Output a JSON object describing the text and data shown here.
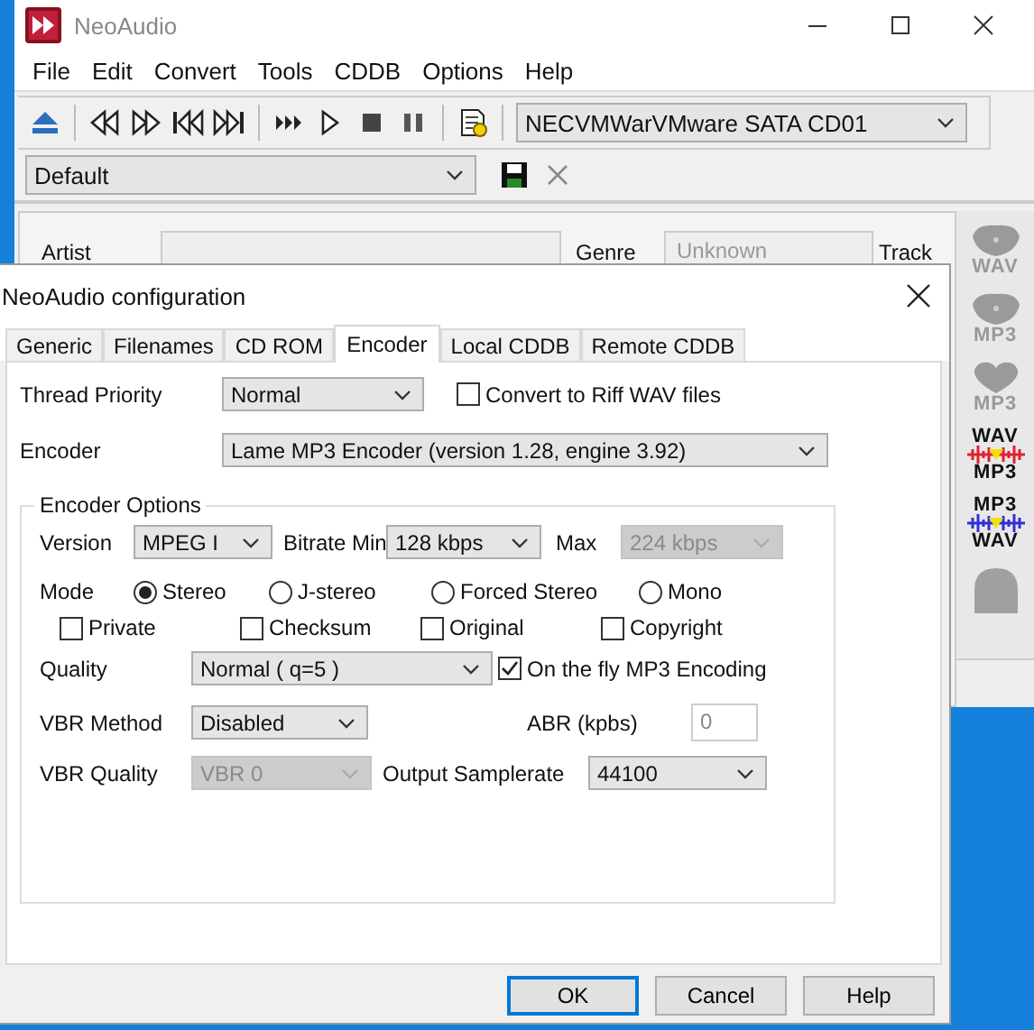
{
  "main_window": {
    "title": "NeoAudio",
    "menu": [
      "File",
      "Edit",
      "Convert",
      "Tools",
      "CDDB",
      "Options",
      "Help"
    ],
    "drive_select": {
      "value": "NECVMWarVMware SATA CD01"
    },
    "preset_select": {
      "value": "Default"
    },
    "info": {
      "artist_label": "Artist",
      "genre_label": "Genre",
      "genre": {
        "value": "Unknown",
        "disabled": true
      },
      "track_label": "Track"
    },
    "side_buttons": [
      {
        "kind": "disc",
        "label": "WAV"
      },
      {
        "kind": "disc",
        "label": "MP3"
      },
      {
        "kind": "heart",
        "label": "MP3"
      },
      {
        "kind": "convert",
        "from": "WAV",
        "to": "MP3",
        "color": "#e02030"
      },
      {
        "kind": "convert",
        "from": "MP3",
        "to": "WAV",
        "color": "#3030d8"
      },
      {
        "kind": "dome"
      }
    ]
  },
  "dialog": {
    "title": "NeoAudio configuration",
    "tabs": [
      {
        "label": "Generic",
        "selected": false
      },
      {
        "label": "Filenames",
        "selected": false
      },
      {
        "label": "CD ROM",
        "selected": false
      },
      {
        "label": "Encoder",
        "selected": true
      },
      {
        "label": "Local CDDB",
        "selected": false
      },
      {
        "label": "Remote CDDB",
        "selected": false
      }
    ],
    "thread_priority": {
      "label": "Thread Priority",
      "value": "Normal"
    },
    "riff_wav": {
      "label": "Convert to Riff WAV files",
      "checked": false
    },
    "encoder": {
      "label": "Encoder",
      "value": "Lame MP3 Encoder (version 1.28, engine 3.92)"
    },
    "options": {
      "title": "Encoder Options",
      "version": {
        "label": "Version",
        "value": "MPEG I"
      },
      "bitrate_min": {
        "label": "Bitrate Min",
        "value": "128 kbps"
      },
      "bitrate_max": {
        "label": "Max",
        "value": "224 kbps",
        "disabled": true
      },
      "mode": {
        "label": "Mode",
        "choices": [
          {
            "label": "Stereo",
            "selected": true
          },
          {
            "label": "J-stereo",
            "selected": false
          },
          {
            "label": "Forced Stereo",
            "selected": false
          },
          {
            "label": "Mono",
            "selected": false
          }
        ]
      },
      "flags": [
        {
          "label": "Private",
          "checked": false
        },
        {
          "label": "Checksum",
          "checked": false
        },
        {
          "label": "Original",
          "checked": false
        },
        {
          "label": "Copyright",
          "checked": false
        }
      ],
      "quality": {
        "label": "Quality",
        "value": "Normal ( q=5 )"
      },
      "on_the_fly": {
        "label": "On the fly MP3 Encoding",
        "checked": true
      },
      "vbr_method": {
        "label": "VBR Method",
        "value": "Disabled"
      },
      "abr": {
        "label": "ABR (kpbs)",
        "value": "0",
        "disabled": true
      },
      "vbr_quality": {
        "label": "VBR Quality",
        "value": "VBR 0",
        "disabled": true
      },
      "samplerate": {
        "label": "Output Samplerate",
        "value": "44100"
      }
    },
    "buttons": [
      {
        "label": "OK",
        "default": true
      },
      {
        "label": "Cancel",
        "default": false
      },
      {
        "label": "Help",
        "default": false
      }
    ]
  }
}
